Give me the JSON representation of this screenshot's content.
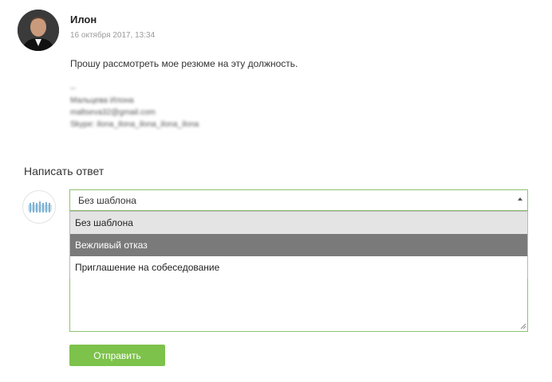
{
  "message": {
    "author": "Илон",
    "timestamp": "16 октября 2017, 13:34",
    "text": "Прошу рассмотреть мое резюме на эту должность.",
    "signature": {
      "separator": "--",
      "name": "Мальцева Илона",
      "email": "maltseva32@gmail.com",
      "skype": "Skype: ilona_ilona_ilona_ilona_ilona"
    }
  },
  "reply": {
    "title": "Написать ответ",
    "template_select": {
      "selected": "Без шаблона",
      "options": [
        "Без шаблона",
        "Вежливый отказ",
        "Приглашение на собеседование"
      ],
      "highlighted_index": 1
    },
    "send_label": "Отправить"
  },
  "colors": {
    "accent": "#7dc24b",
    "field_border": "#8ec26f",
    "highlight": "#7a7a7a"
  }
}
